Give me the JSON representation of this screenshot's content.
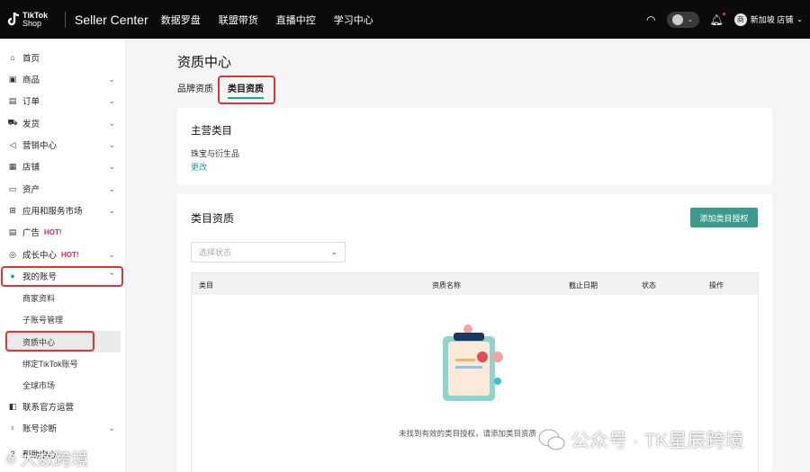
{
  "topbar": {
    "logo_line1": "TikTok",
    "logo_line2": "Shop",
    "brand": "Seller Center",
    "nav": [
      "数据罗盘",
      "联盟带货",
      "直播中控",
      "学习中心"
    ],
    "store_label": "新加坡 店铺",
    "store_avatar": "商"
  },
  "sidebar": {
    "items": [
      {
        "label": "首页",
        "icon": "home-icon",
        "glyph": "⌂"
      },
      {
        "label": "商品",
        "icon": "product-icon",
        "glyph": "▣"
      },
      {
        "label": "订单",
        "icon": "order-icon",
        "glyph": "▤"
      },
      {
        "label": "发货",
        "icon": "truck-icon",
        "glyph": "⛟"
      },
      {
        "label": "营销中心",
        "icon": "megaphone-icon",
        "glyph": "◁"
      },
      {
        "label": "店铺",
        "icon": "store-icon",
        "glyph": "▦"
      },
      {
        "label": "资产",
        "icon": "wallet-icon",
        "glyph": "▭"
      },
      {
        "label": "应用和服务市场",
        "icon": "apps-icon",
        "glyph": "⊞"
      },
      {
        "label": "广告",
        "icon": "ad-icon",
        "glyph": "▤",
        "badge": "HOT!"
      },
      {
        "label": "成长中心",
        "icon": "growth-icon",
        "glyph": "◎",
        "badge": "HOT!"
      },
      {
        "label": "我的账号",
        "icon": "user-icon",
        "glyph": "●"
      }
    ],
    "subitems": [
      "商家资料",
      "子账号管理",
      "资质中心",
      "绑定TikTok账号",
      "全球市场"
    ],
    "bottom_items": [
      {
        "label": "联系官方运营",
        "icon": "contact-icon",
        "glyph": "◧"
      },
      {
        "label": "账号诊断",
        "icon": "diagnosis-icon",
        "glyph": "♀"
      },
      {
        "label": "帮助中心",
        "icon": "help-icon",
        "glyph": "?"
      }
    ]
  },
  "main": {
    "title": "资质中心",
    "tabs": [
      "品牌资质",
      "类目资质"
    ],
    "main_category": {
      "heading": "主营类目",
      "value": "珠宝与衍生品",
      "change_link": "更改"
    },
    "category_qual": {
      "heading": "类目资质",
      "add_button": "添加类目授权",
      "status_placeholder": "选择状态",
      "columns": [
        "类目",
        "资质名称",
        "截止日期",
        "状态",
        "操作"
      ],
      "empty_text": "未找到有效的类目授权，请添加类目资质"
    }
  },
  "watermarks": {
    "wechat": "公众号 · TK星辰跨境",
    "corner": "大数跨境"
  },
  "colors": {
    "accent": "#3a9a8c",
    "link": "#18a0a0",
    "highlight_box": "#e0343a",
    "hot": "#e0245e"
  }
}
